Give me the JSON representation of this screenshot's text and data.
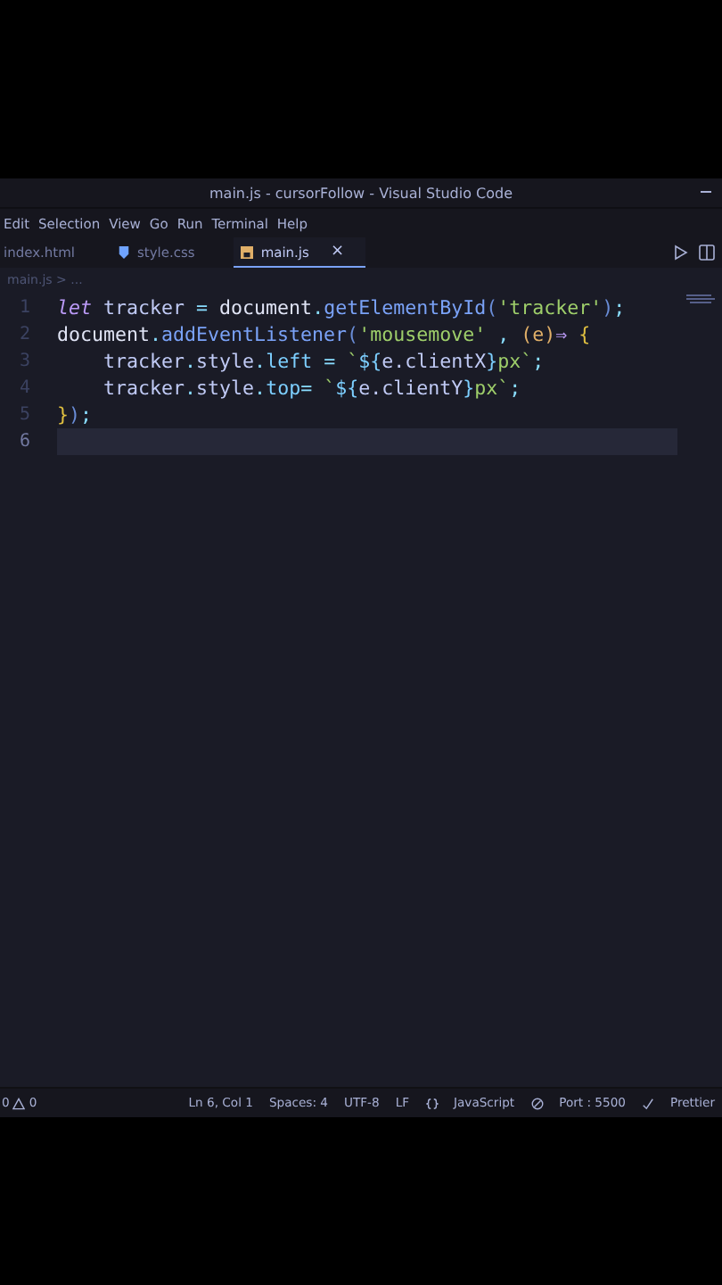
{
  "window": {
    "title": "main.js - cursorFollow - Visual Studio Code"
  },
  "menu": [
    "Edit",
    "Selection",
    "View",
    "Go",
    "Run",
    "Terminal",
    "Help"
  ],
  "tabs": [
    {
      "label": "index.html",
      "selected": false
    },
    {
      "label": "style.css",
      "selected": false
    },
    {
      "label": "main.js",
      "selected": true
    }
  ],
  "tab_close": "×",
  "breadcrumb": "main.js > ...",
  "editor": {
    "lines": [
      {
        "number": "1",
        "current": false,
        "tokens": [
          {
            "kind": "keyword",
            "text": "let "
          },
          {
            "kind": "variable",
            "text": "tracker"
          },
          {
            "kind": "operator",
            "text": " = "
          },
          {
            "kind": "object",
            "text": "document"
          },
          {
            "kind": "punct",
            "text": "."
          },
          {
            "kind": "method",
            "text": "getElementById"
          },
          {
            "kind": "paren",
            "text": "("
          },
          {
            "kind": "string",
            "text": "'tracker'"
          },
          {
            "kind": "paren",
            "text": ")"
          },
          {
            "kind": "punct",
            "text": ";"
          }
        ]
      },
      {
        "number": "2",
        "current": false,
        "tokens": [
          {
            "kind": "object",
            "text": "document"
          },
          {
            "kind": "punct",
            "text": "."
          },
          {
            "kind": "method",
            "text": "addEventListener"
          },
          {
            "kind": "paren",
            "text": "("
          },
          {
            "kind": "string",
            "text": "'mousemove'"
          },
          {
            "kind": "punct",
            "text": " , "
          },
          {
            "kind": "param",
            "text": "(e)"
          },
          {
            "kind": "keyword",
            "text": "⇒ "
          },
          {
            "kind": "brace",
            "text": "{"
          }
        ]
      },
      {
        "number": "3",
        "current": false,
        "tokens": [
          {
            "kind": "variable",
            "text": "    tracker"
          },
          {
            "kind": "punct",
            "text": "."
          },
          {
            "kind": "variable",
            "text": "style"
          },
          {
            "kind": "punct",
            "text": "."
          },
          {
            "kind": "property",
            "text": "left"
          },
          {
            "kind": "operator",
            "text": " = "
          },
          {
            "kind": "string",
            "text": "`"
          },
          {
            "kind": "interp",
            "text": "${"
          },
          {
            "kind": "variable",
            "text": "e.clientX"
          },
          {
            "kind": "interp",
            "text": "}"
          },
          {
            "kind": "string",
            "text": "px`"
          },
          {
            "kind": "punct",
            "text": ";"
          }
        ]
      },
      {
        "number": "4",
        "current": false,
        "tokens": [
          {
            "kind": "variable",
            "text": "    tracker"
          },
          {
            "kind": "punct",
            "text": "."
          },
          {
            "kind": "variable",
            "text": "style"
          },
          {
            "kind": "punct",
            "text": "."
          },
          {
            "kind": "property",
            "text": "top"
          },
          {
            "kind": "operator",
            "text": "= "
          },
          {
            "kind": "string",
            "text": "`"
          },
          {
            "kind": "interp",
            "text": "${"
          },
          {
            "kind": "variable",
            "text": "e.clientY"
          },
          {
            "kind": "interp",
            "text": "}"
          },
          {
            "kind": "string",
            "text": "px`"
          },
          {
            "kind": "punct",
            "text": ";"
          }
        ]
      },
      {
        "number": "5",
        "current": false,
        "tokens": [
          {
            "kind": "brace",
            "text": "}"
          },
          {
            "kind": "paren",
            "text": ")"
          },
          {
            "kind": "punct",
            "text": ";"
          }
        ]
      },
      {
        "number": "6",
        "current": true
      }
    ]
  },
  "status_bar": {
    "errors": "0",
    "warnings": "0",
    "items": [
      "Ln 6, Col 1",
      "Spaces: 4",
      "UTF-8",
      "LF",
      "JavaScript",
      "Port : 5500",
      "Prettier"
    ]
  }
}
